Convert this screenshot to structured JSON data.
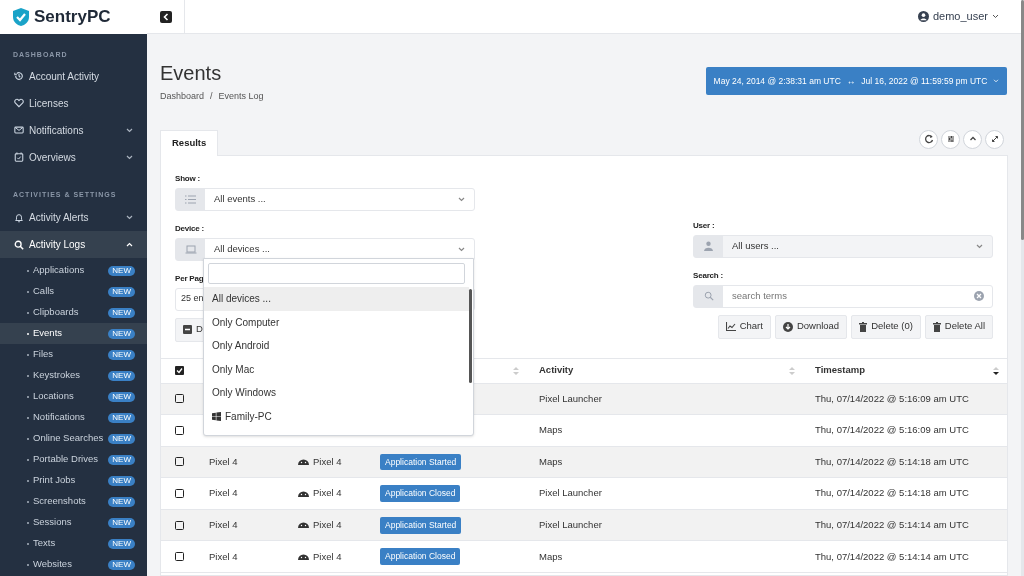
{
  "brand": {
    "name": "SentryPC"
  },
  "sidebar": {
    "sections": [
      {
        "heading": "DASHBOARD",
        "items": [
          {
            "label": "Account Activity",
            "has_caret": false,
            "expanded": false
          },
          {
            "label": "Licenses",
            "has_caret": false,
            "expanded": false
          },
          {
            "label": "Notifications",
            "has_caret": true,
            "expanded": false
          },
          {
            "label": "Overviews",
            "has_caret": true,
            "expanded": false
          }
        ]
      },
      {
        "heading": "ACTIVITIES & SETTINGS",
        "items": [
          {
            "label": "Activity Alerts",
            "has_caret": true,
            "expanded": false
          },
          {
            "label": "Activity Logs",
            "has_caret": true,
            "expanded": true,
            "children": [
              {
                "label": "Applications",
                "badge": "NEW",
                "selected": false
              },
              {
                "label": "Calls",
                "badge": "NEW",
                "selected": false
              },
              {
                "label": "Clipboards",
                "badge": "NEW",
                "selected": false
              },
              {
                "label": "Events",
                "badge": "NEW",
                "selected": true
              },
              {
                "label": "Files",
                "badge": "NEW",
                "selected": false
              },
              {
                "label": "Keystrokes",
                "badge": "NEW",
                "selected": false
              },
              {
                "label": "Locations",
                "badge": "NEW",
                "selected": false
              },
              {
                "label": "Notifications",
                "badge": "NEW",
                "selected": false
              },
              {
                "label": "Online Searches",
                "badge": "NEW",
                "selected": false
              },
              {
                "label": "Portable Drives",
                "badge": "NEW",
                "selected": false
              },
              {
                "label": "Print Jobs",
                "badge": "NEW",
                "selected": false
              },
              {
                "label": "Screenshots",
                "badge": "NEW",
                "selected": false
              },
              {
                "label": "Sessions",
                "badge": "NEW",
                "selected": false
              },
              {
                "label": "Texts",
                "badge": "NEW",
                "selected": false
              },
              {
                "label": "Websites",
                "badge": "NEW",
                "selected": false
              }
            ]
          }
        ]
      }
    ]
  },
  "topbar": {
    "user": "demo_user"
  },
  "page": {
    "title": "Events",
    "breadcrumb": [
      "Dashboard",
      "/",
      "Events Log"
    ],
    "date_range": {
      "start": "May 24, 2014 @ 2:38:31 am UTC",
      "separator": "↔",
      "end": "Jul 16, 2022 @ 11:59:59 pm UTC"
    }
  },
  "tabs": [
    {
      "label": "Results",
      "selected": true
    }
  ],
  "filters": {
    "show": {
      "label": "Show :",
      "value": "All events ..."
    },
    "device": {
      "label": "Device :",
      "value": "All devices ..."
    },
    "user": {
      "label": "User :",
      "value": "All users ..."
    },
    "per_page": {
      "label": "Per Pag",
      "value": "25 en"
    },
    "search": {
      "label": "Search :",
      "placeholder": "search terms"
    }
  },
  "actions": [
    {
      "label": "D"
    },
    {
      "label": "Chart"
    },
    {
      "label": "Download"
    },
    {
      "label": "Delete (0)"
    },
    {
      "label": "Delete All"
    }
  ],
  "table": {
    "select_all": true,
    "columns": [
      {
        "label": "Activity"
      },
      {
        "label": "Timestamp"
      }
    ],
    "rows": [
      {
        "checked": false,
        "activity": "Pixel Launcher",
        "timestamp": "Thu, 07/14/2022 @ 5:16:09 am UTC"
      },
      {
        "checked": false,
        "activity": "Maps",
        "timestamp": "Thu, 07/14/2022 @ 5:16:09 am UTC"
      },
      {
        "checked": false,
        "user": "Pixel 4",
        "device": "Pixel 4",
        "event": "Application Started",
        "activity": "Maps",
        "timestamp": "Thu, 07/14/2022 @ 5:14:18 am UTC"
      },
      {
        "checked": false,
        "user": "Pixel 4",
        "device": "Pixel 4",
        "event": "Application Closed",
        "activity": "Pixel Launcher",
        "timestamp": "Thu, 07/14/2022 @ 5:14:18 am UTC"
      },
      {
        "checked": false,
        "user": "Pixel 4",
        "device": "Pixel 4",
        "event": "Application Started",
        "activity": "Pixel Launcher",
        "timestamp": "Thu, 07/14/2022 @ 5:14:14 am UTC"
      },
      {
        "checked": false,
        "user": "Pixel 4",
        "device": "Pixel 4",
        "event": "Application Closed",
        "activity": "Maps",
        "timestamp": "Thu, 07/14/2022 @ 5:14:14 am UTC"
      }
    ]
  },
  "device_dropdown": {
    "options": [
      {
        "label": "All devices ...",
        "selected": true
      },
      {
        "label": "Only Computer",
        "selected": false
      },
      {
        "label": "Only Android",
        "selected": false
      },
      {
        "label": "Only Mac",
        "selected": false
      },
      {
        "label": "Only Windows",
        "selected": false
      },
      {
        "label": "Family-PC",
        "selected": false,
        "kind": "windows"
      }
    ]
  }
}
